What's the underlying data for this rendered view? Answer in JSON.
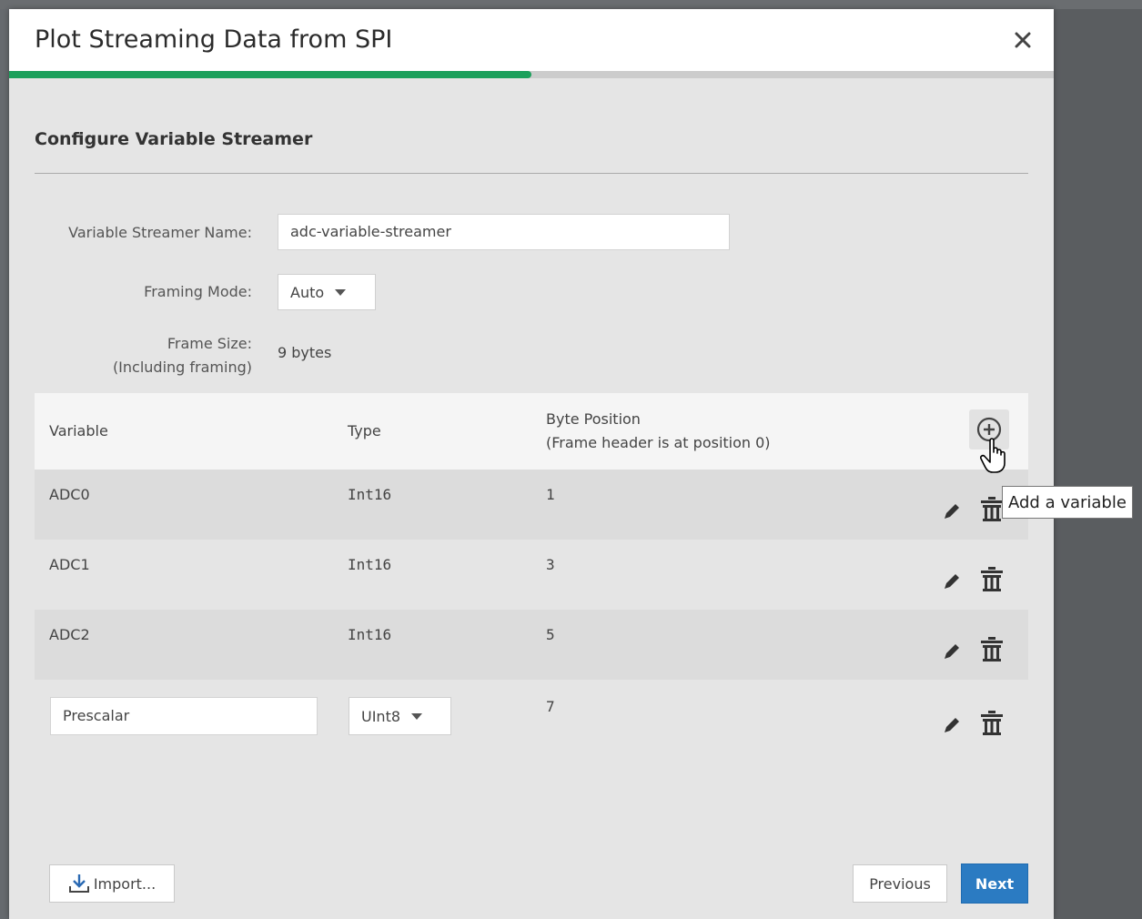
{
  "dialog": {
    "title": "Plot Streaming Data from SPI",
    "close_icon": "close-icon",
    "progress_fraction": 0.5
  },
  "section": {
    "title": "Configure Variable Streamer"
  },
  "form": {
    "name_label": "Variable Streamer Name:",
    "name_value": "adc-variable-streamer",
    "framing_label": "Framing Mode:",
    "framing_value": "Auto",
    "frame_size_label_line1": "Frame Size:",
    "frame_size_label_line2": "(Including framing)",
    "frame_size_value": "9 bytes"
  },
  "table": {
    "headers": {
      "variable": "Variable",
      "type": "Type",
      "byte_position_line1": "Byte Position",
      "byte_position_line2": "(Frame header is at position 0)"
    },
    "rows": [
      {
        "variable": "ADC0",
        "type": "Int16",
        "byte_position": "1"
      },
      {
        "variable": "ADC1",
        "type": "Int16",
        "byte_position": "3"
      },
      {
        "variable": "ADC2",
        "type": "Int16",
        "byte_position": "5"
      }
    ],
    "edit_row": {
      "variable": "Prescalar",
      "type": "UInt8",
      "byte_position": "7"
    }
  },
  "tooltip": {
    "text": "Add a variable"
  },
  "footer": {
    "import_label": "Import...",
    "previous_label": "Previous",
    "next_label": "Next"
  },
  "colors": {
    "progress": "#1ba05b",
    "primary_button": "#2b7bc2",
    "dialog_background": "#e5e5e5",
    "overlay": "#5a5d60"
  }
}
